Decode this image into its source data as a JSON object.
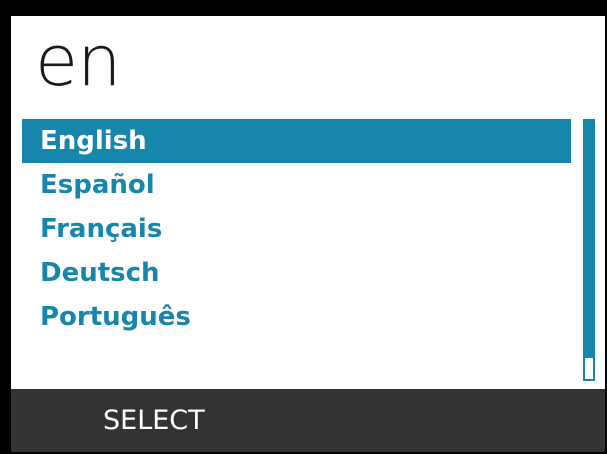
{
  "header": {
    "language_code": "en"
  },
  "language_list": {
    "selected_index": 0,
    "items": [
      {
        "label": "English"
      },
      {
        "label": "Español"
      },
      {
        "label": "Français"
      },
      {
        "label": "Deutsch"
      },
      {
        "label": "Português"
      }
    ]
  },
  "scrollbar": {
    "visible_fraction": 0.92
  },
  "footer": {
    "select_label": "SELECT"
  },
  "colors": {
    "accent": "#1686ad",
    "footer_bg": "#333333",
    "background": "#ffffff"
  }
}
